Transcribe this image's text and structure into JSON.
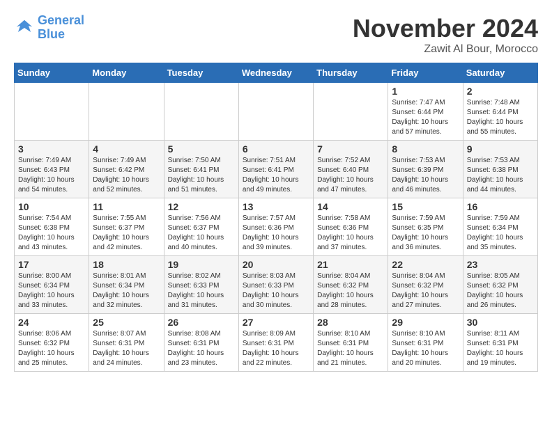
{
  "header": {
    "logo_line1": "General",
    "logo_line2": "Blue",
    "month_year": "November 2024",
    "location": "Zawit Al Bour, Morocco"
  },
  "weekdays": [
    "Sunday",
    "Monday",
    "Tuesday",
    "Wednesday",
    "Thursday",
    "Friday",
    "Saturday"
  ],
  "weeks": [
    [
      {
        "day": "",
        "info": ""
      },
      {
        "day": "",
        "info": ""
      },
      {
        "day": "",
        "info": ""
      },
      {
        "day": "",
        "info": ""
      },
      {
        "day": "",
        "info": ""
      },
      {
        "day": "1",
        "info": "Sunrise: 7:47 AM\nSunset: 6:44 PM\nDaylight: 10 hours and 57 minutes."
      },
      {
        "day": "2",
        "info": "Sunrise: 7:48 AM\nSunset: 6:44 PM\nDaylight: 10 hours and 55 minutes."
      }
    ],
    [
      {
        "day": "3",
        "info": "Sunrise: 7:49 AM\nSunset: 6:43 PM\nDaylight: 10 hours and 54 minutes."
      },
      {
        "day": "4",
        "info": "Sunrise: 7:49 AM\nSunset: 6:42 PM\nDaylight: 10 hours and 52 minutes."
      },
      {
        "day": "5",
        "info": "Sunrise: 7:50 AM\nSunset: 6:41 PM\nDaylight: 10 hours and 51 minutes."
      },
      {
        "day": "6",
        "info": "Sunrise: 7:51 AM\nSunset: 6:41 PM\nDaylight: 10 hours and 49 minutes."
      },
      {
        "day": "7",
        "info": "Sunrise: 7:52 AM\nSunset: 6:40 PM\nDaylight: 10 hours and 47 minutes."
      },
      {
        "day": "8",
        "info": "Sunrise: 7:53 AM\nSunset: 6:39 PM\nDaylight: 10 hours and 46 minutes."
      },
      {
        "day": "9",
        "info": "Sunrise: 7:53 AM\nSunset: 6:38 PM\nDaylight: 10 hours and 44 minutes."
      }
    ],
    [
      {
        "day": "10",
        "info": "Sunrise: 7:54 AM\nSunset: 6:38 PM\nDaylight: 10 hours and 43 minutes."
      },
      {
        "day": "11",
        "info": "Sunrise: 7:55 AM\nSunset: 6:37 PM\nDaylight: 10 hours and 42 minutes."
      },
      {
        "day": "12",
        "info": "Sunrise: 7:56 AM\nSunset: 6:37 PM\nDaylight: 10 hours and 40 minutes."
      },
      {
        "day": "13",
        "info": "Sunrise: 7:57 AM\nSunset: 6:36 PM\nDaylight: 10 hours and 39 minutes."
      },
      {
        "day": "14",
        "info": "Sunrise: 7:58 AM\nSunset: 6:36 PM\nDaylight: 10 hours and 37 minutes."
      },
      {
        "day": "15",
        "info": "Sunrise: 7:59 AM\nSunset: 6:35 PM\nDaylight: 10 hours and 36 minutes."
      },
      {
        "day": "16",
        "info": "Sunrise: 7:59 AM\nSunset: 6:34 PM\nDaylight: 10 hours and 35 minutes."
      }
    ],
    [
      {
        "day": "17",
        "info": "Sunrise: 8:00 AM\nSunset: 6:34 PM\nDaylight: 10 hours and 33 minutes."
      },
      {
        "day": "18",
        "info": "Sunrise: 8:01 AM\nSunset: 6:34 PM\nDaylight: 10 hours and 32 minutes."
      },
      {
        "day": "19",
        "info": "Sunrise: 8:02 AM\nSunset: 6:33 PM\nDaylight: 10 hours and 31 minutes."
      },
      {
        "day": "20",
        "info": "Sunrise: 8:03 AM\nSunset: 6:33 PM\nDaylight: 10 hours and 30 minutes."
      },
      {
        "day": "21",
        "info": "Sunrise: 8:04 AM\nSunset: 6:32 PM\nDaylight: 10 hours and 28 minutes."
      },
      {
        "day": "22",
        "info": "Sunrise: 8:04 AM\nSunset: 6:32 PM\nDaylight: 10 hours and 27 minutes."
      },
      {
        "day": "23",
        "info": "Sunrise: 8:05 AM\nSunset: 6:32 PM\nDaylight: 10 hours and 26 minutes."
      }
    ],
    [
      {
        "day": "24",
        "info": "Sunrise: 8:06 AM\nSunset: 6:32 PM\nDaylight: 10 hours and 25 minutes."
      },
      {
        "day": "25",
        "info": "Sunrise: 8:07 AM\nSunset: 6:31 PM\nDaylight: 10 hours and 24 minutes."
      },
      {
        "day": "26",
        "info": "Sunrise: 8:08 AM\nSunset: 6:31 PM\nDaylight: 10 hours and 23 minutes."
      },
      {
        "day": "27",
        "info": "Sunrise: 8:09 AM\nSunset: 6:31 PM\nDaylight: 10 hours and 22 minutes."
      },
      {
        "day": "28",
        "info": "Sunrise: 8:10 AM\nSunset: 6:31 PM\nDaylight: 10 hours and 21 minutes."
      },
      {
        "day": "29",
        "info": "Sunrise: 8:10 AM\nSunset: 6:31 PM\nDaylight: 10 hours and 20 minutes."
      },
      {
        "day": "30",
        "info": "Sunrise: 8:11 AM\nSunset: 6:31 PM\nDaylight: 10 hours and 19 minutes."
      }
    ]
  ]
}
